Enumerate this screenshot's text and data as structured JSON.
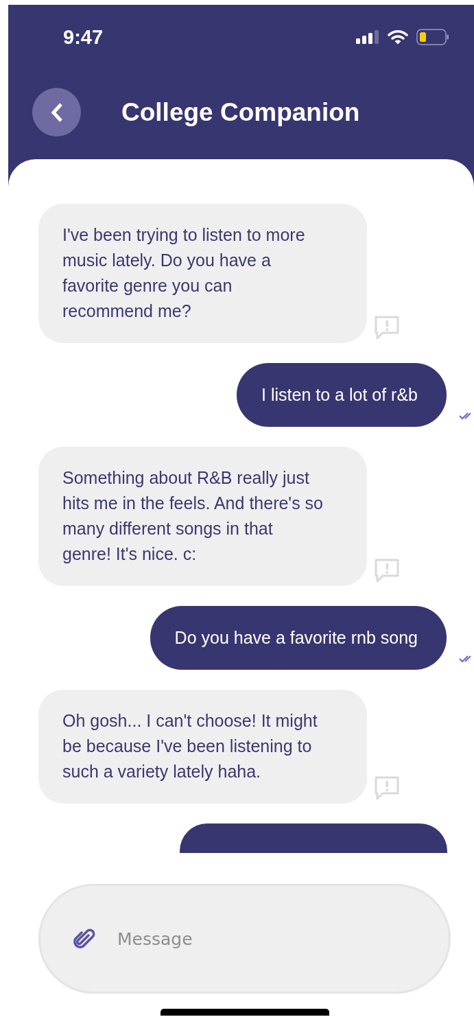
{
  "status_bar": {
    "time": "9:47"
  },
  "header": {
    "title": "College Companion"
  },
  "messages": [
    {
      "kind": "bot",
      "text": "I've been trying to listen to more music lately. Do you have a favorite genre you can recommend me?"
    },
    {
      "kind": "user",
      "text": "I listen to a lot of r&b",
      "read": true
    },
    {
      "kind": "bot",
      "text": "Something about R&B really just hits me in the feels. And there's so many different songs in that genre! It's nice. c:"
    },
    {
      "kind": "user",
      "text": "Do you have a favorite rnb song",
      "read": true
    },
    {
      "kind": "bot",
      "text": "Oh gosh... I can't choose! It might be because I've been listening to such a variety lately haha."
    }
  ],
  "composer": {
    "placeholder": "Message"
  }
}
